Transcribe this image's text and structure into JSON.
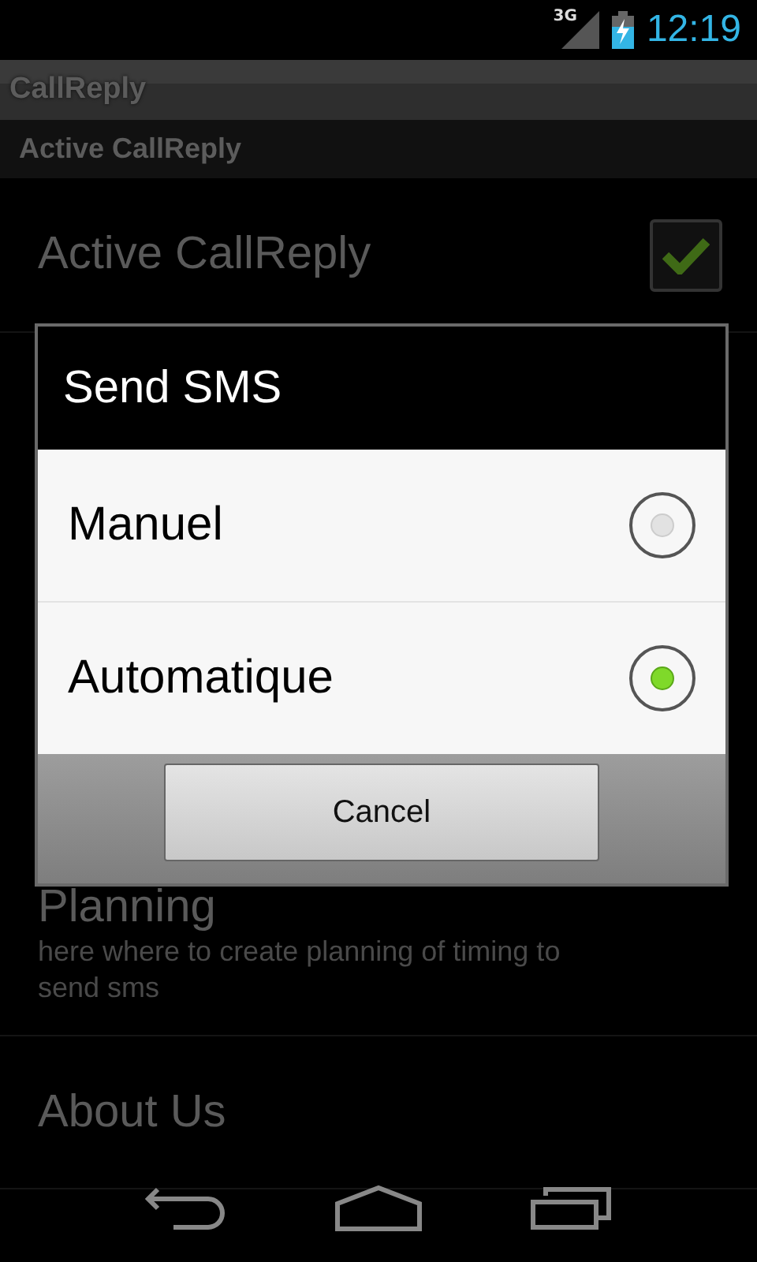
{
  "status_bar": {
    "network": "3G",
    "time": "12:19"
  },
  "app_bar": {
    "title": "CallReply"
  },
  "category": {
    "title": "Active CallReply"
  },
  "preferences": [
    {
      "kind": "checkbox",
      "title": "Active CallReply",
      "checked": true
    },
    {
      "kind": "text",
      "title": "Planning",
      "summary": "here where to create planning of timing to send sms"
    },
    {
      "kind": "text",
      "title": "About Us"
    }
  ],
  "dialog": {
    "title": "Send SMS",
    "options": [
      {
        "label": "Manuel",
        "selected": false
      },
      {
        "label": "Automatique",
        "selected": true
      }
    ],
    "buttons": [
      "Cancel"
    ]
  }
}
